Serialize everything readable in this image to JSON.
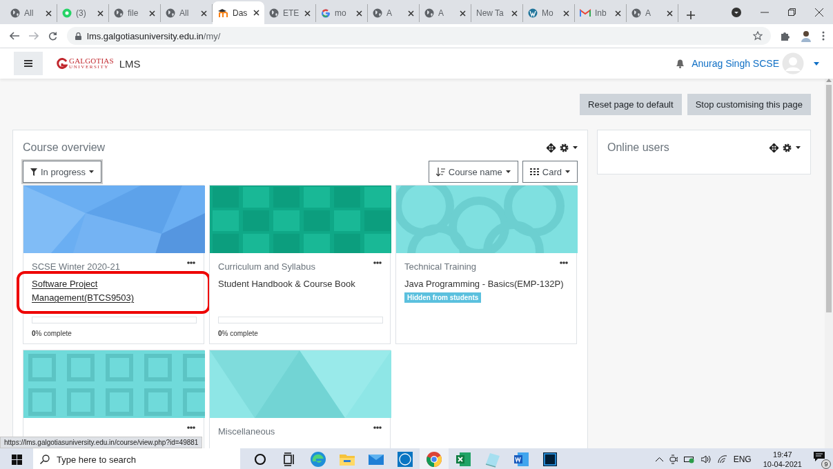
{
  "browser": {
    "tabs": [
      {
        "title": "All",
        "kind": "globe",
        "selected": false
      },
      {
        "title": "(3)",
        "kind": "whatsapp",
        "selected": false
      },
      {
        "title": "file",
        "kind": "globe",
        "selected": false
      },
      {
        "title": "All",
        "kind": "globe",
        "selected": false
      },
      {
        "title": "Das",
        "kind": "moodle",
        "selected": true
      },
      {
        "title": "ETE",
        "kind": "globe",
        "selected": false
      },
      {
        "title": "mo",
        "kind": "google",
        "selected": false
      },
      {
        "title": "A",
        "kind": "globe",
        "selected": false
      },
      {
        "title": "A",
        "kind": "globe",
        "selected": false
      },
      {
        "title": "New Ta",
        "kind": "blank",
        "selected": false
      },
      {
        "title": "Mo",
        "kind": "wordpress",
        "selected": false
      },
      {
        "title": "Inb",
        "kind": "gmail",
        "selected": false
      },
      {
        "title": "A",
        "kind": "globe",
        "selected": false
      }
    ],
    "address": {
      "host": "lms.galgotiasuniversity.edu.in",
      "path": "/my/"
    }
  },
  "navbar": {
    "logo": {
      "name": "GALGOTIAS",
      "subtitle": "UNIVERSITY"
    },
    "site_name": "LMS",
    "user_name": "Anurag Singh SCSE"
  },
  "page_buttons": [
    "Reset page to default",
    "Stop customising this page"
  ],
  "course_overview": {
    "title": "Course overview",
    "filter": "In progress",
    "sort": "Course name",
    "view": "Card",
    "courses": [
      {
        "category": "SCSE Winter 2020-21",
        "name": "Software Project Management(BTCS9503)",
        "hovered": true,
        "highlighted": true,
        "progress": {
          "level": 0,
          "label": "**0**% complete"
        }
      },
      {
        "category": "Curriculum and Syllabus",
        "name": "Student Handbook & Course Book",
        "hovered": false,
        "highlighted": false,
        "progress": {
          "level": 0,
          "label": "**0**% complete"
        }
      },
      {
        "category": "Technical Training",
        "name": "Java Programming - Basics(EMP-132P)",
        "hovered": false,
        "highlighted": false,
        "badge": "Hidden from students"
      },
      {
        "highlighted": false
      },
      {
        "category": "Miscellaneous",
        "highlighted": false
      }
    ]
  },
  "online_users": {
    "title": "Online users"
  },
  "status_url": "https://lms.galgotiasuniversity.edu.in/course/view.php?id=49881",
  "taskbar": {
    "search_placeholder": "Type here to search",
    "apps": [
      {
        "kind": "cortana",
        "active": false
      },
      {
        "kind": "taskview",
        "active": false
      },
      {
        "kind": "edge",
        "active": false
      },
      {
        "kind": "explorer",
        "active": false
      },
      {
        "kind": "mail",
        "active": false
      },
      {
        "kind": "dell",
        "active": false
      },
      {
        "kind": "chrome",
        "active": true
      },
      {
        "kind": "excel",
        "active": false
      },
      {
        "kind": "notepad",
        "active": false
      },
      {
        "kind": "word",
        "active": false
      },
      {
        "kind": "photoshop",
        "active": false
      }
    ],
    "language": "ENG",
    "time": "19:47",
    "date": "10-04-2021",
    "notifications": "9"
  }
}
